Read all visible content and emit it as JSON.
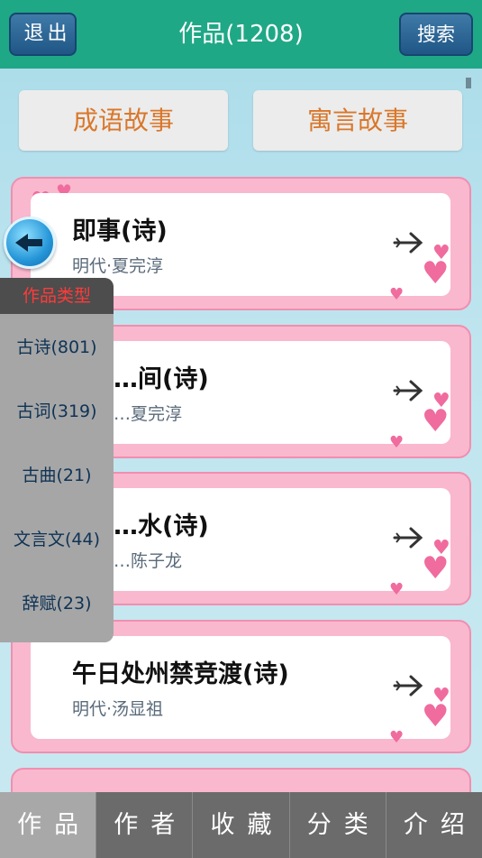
{
  "header": {
    "exit_label": "退出",
    "title": "作品(1208)",
    "search_label": "搜索",
    "bg_color": "#1fa886"
  },
  "top_categories": [
    "成语故事",
    "寓言故事"
  ],
  "cards": [
    {
      "title": "即事(诗)",
      "author": "明代·夏完淳"
    },
    {
      "title": "…间(诗)",
      "author": "…夏完淳"
    },
    {
      "title": "…水(诗)",
      "author": "…陈子龙"
    },
    {
      "title": "午日处州禁竞渡(诗)",
      "author": "明代·汤显祖"
    }
  ],
  "side_panel": {
    "header": "作品类型",
    "items": [
      "古诗(801)",
      "古词(319)",
      "古曲(21)",
      "文言文(44)",
      "辞赋(23)"
    ]
  },
  "bottom_nav": {
    "items": [
      "作品",
      "作者",
      "收藏",
      "分类",
      "介绍"
    ],
    "active_index": 0
  },
  "icons": {
    "back": "back-arrow-icon",
    "card_arrow": "arrow-right-icon",
    "decoration": "heart-icon"
  }
}
